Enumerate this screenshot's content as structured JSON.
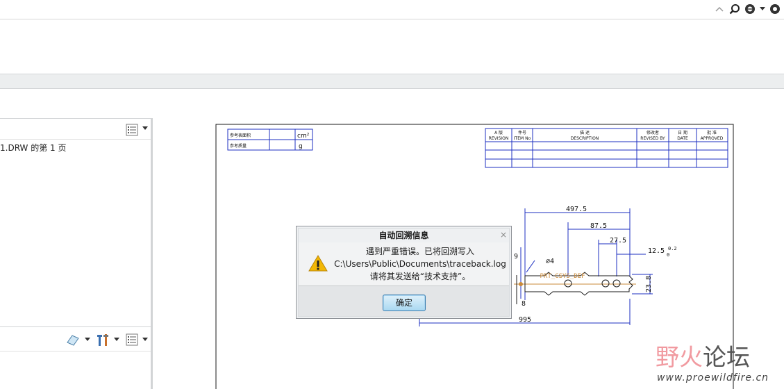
{
  "left_panel": {
    "page_label": "1.DRW 的第 1 页"
  },
  "title_block_left": {
    "rows": [
      {
        "label": "参考表面积",
        "unit": "cm²"
      },
      {
        "label": "参考质量",
        "unit": "g"
      }
    ]
  },
  "revision_table": {
    "headers": [
      {
        "cn": "版 次",
        "en": "REVISION",
        "prefix": "A 版"
      },
      {
        "cn": "件号",
        "en": "ITEM No"
      },
      {
        "cn": "描      述",
        "en": "DESCRIPTION"
      },
      {
        "cn": "修改者",
        "en": "REVISED BY"
      },
      {
        "cn": "日 期",
        "en": "DATE"
      },
      {
        "cn": "批 准",
        "en": "APPROVED"
      }
    ]
  },
  "dimensions": {
    "d1": "497.5",
    "d2": "87.5",
    "d3": "27.5",
    "d4": "12.5",
    "d4_tol": "0.2",
    "d4_tol_lower": "0",
    "dia": "∅4",
    "left": "9",
    "height": "23.8",
    "small": "8",
    "total": "995",
    "csys_label": "PRT_CSYS_DEF"
  },
  "dialog": {
    "title": "自动回溯信息",
    "line1": "遇到严重错误。已将回溯写入",
    "line2": "C:\\Users\\Public\\Documents\\traceback.log",
    "line3": "请将其发送给“技术支持”。",
    "ok": "确定",
    "close": "×"
  },
  "watermark": {
    "part1": "野火",
    "part2": "论坛",
    "url": "www.proewildfire.cn"
  },
  "colors": {
    "dim_blue": "#1c2fc0",
    "csys_orange": "#c98a3a",
    "sheet_border": "#1a1a1a"
  }
}
